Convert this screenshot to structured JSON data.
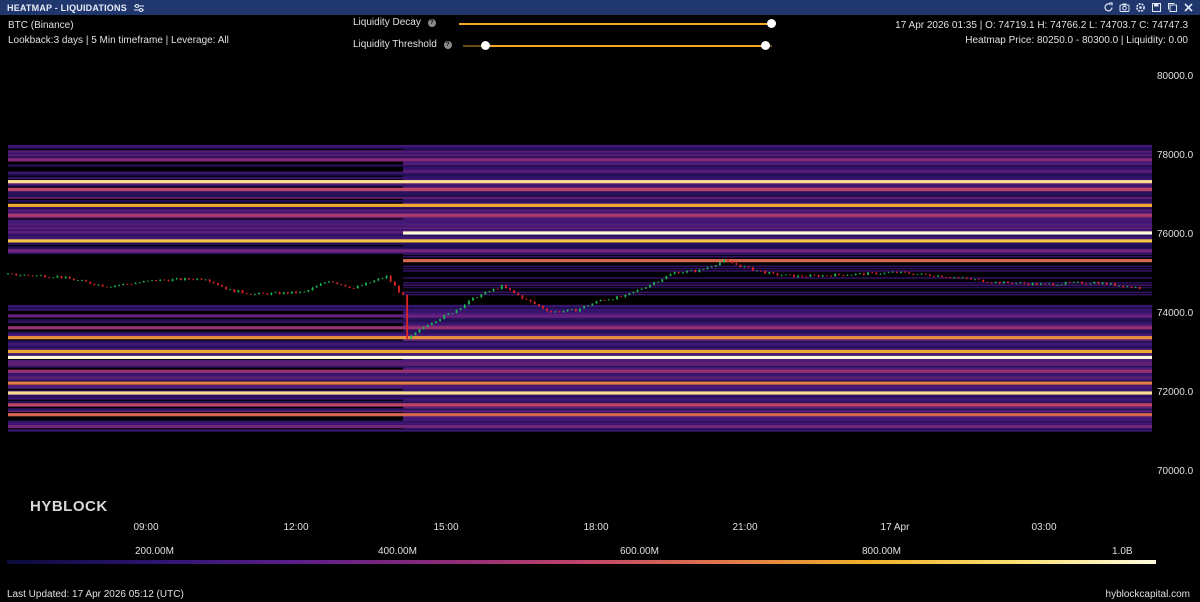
{
  "window": {
    "title": "HEATMAP - LIQUIDATIONS",
    "icons": [
      "refresh-icon",
      "camera-icon",
      "settings-icon",
      "save-icon",
      "copy-icon",
      "close-icon"
    ]
  },
  "info": {
    "symbol": "BTC (Binance)",
    "params": "Lookback:3 days | 5 Min timeframe | Leverage: All",
    "ohlc": "17 Apr 2026 01:35 | O: 74719.1 H: 74766.2 L: 74703.7 C: 74747.3",
    "heatmap_price": "Heatmap Price: 80250.0 - 80300.0 | Liquidity: 0.00"
  },
  "controls": {
    "decay_label": "Liquidity Decay",
    "threshold_label": "Liquidity Threshold",
    "decay_value": 1.0,
    "threshold_range": [
      0.08,
      0.95
    ]
  },
  "brand": {
    "logo": "HYBLOCK",
    "site": "hyblockcapital.com"
  },
  "footer": {
    "updated": "Last Updated: 17 Apr 2026 05:12 (UTC)"
  },
  "legend": {
    "labels": [
      "200.00M",
      "400.00M",
      "600.00M",
      "800.00M",
      "1.0B"
    ]
  },
  "colors": {
    "title_bar": "#20376e",
    "up": "#1db954",
    "down": "#e02424",
    "slider": "#f5a623"
  },
  "chart_data": {
    "type": "heatmap",
    "overlay": "candlestick",
    "x_ticks": [
      "09:00",
      "12:00",
      "15:00",
      "18:00",
      "21:00",
      "17 Apr",
      "03:00"
    ],
    "y_ticks": [
      "80000.0",
      "78000.0",
      "76000.0",
      "74000.0",
      "72000.0",
      "70000.0"
    ],
    "ylim": [
      70000,
      80300
    ],
    "legend_title": "",
    "price_series": [
      {
        "t": "06:00",
        "p": 74950
      },
      {
        "t": "07:00",
        "p": 74900
      },
      {
        "t": "08:00",
        "p": 74650
      },
      {
        "t": "09:00",
        "p": 74800
      },
      {
        "t": "10:00",
        "p": 74850
      },
      {
        "t": "10:30",
        "p": 74550
      },
      {
        "t": "11:00",
        "p": 74450
      },
      {
        "t": "12:00",
        "p": 74500
      },
      {
        "t": "12:30",
        "p": 74800
      },
      {
        "t": "13:00",
        "p": 74600
      },
      {
        "t": "13:40",
        "p": 74900
      },
      {
        "t": "14:00",
        "p": 74400
      },
      {
        "t": "14:05",
        "p": 73300
      },
      {
        "t": "14:30",
        "p": 73700
      },
      {
        "t": "15:00",
        "p": 74000
      },
      {
        "t": "15:30",
        "p": 74400
      },
      {
        "t": "16:00",
        "p": 74650
      },
      {
        "t": "16:30",
        "p": 74300
      },
      {
        "t": "17:00",
        "p": 74000
      },
      {
        "t": "17:30",
        "p": 74050
      },
      {
        "t": "18:00",
        "p": 74300
      },
      {
        "t": "18:30",
        "p": 74400
      },
      {
        "t": "19:00",
        "p": 74700
      },
      {
        "t": "19:30",
        "p": 75000
      },
      {
        "t": "20:00",
        "p": 75050
      },
      {
        "t": "20:30",
        "p": 75300
      },
      {
        "t": "21:00",
        "p": 75100
      },
      {
        "t": "21:30",
        "p": 74950
      },
      {
        "t": "22:00",
        "p": 74900
      },
      {
        "t": "23:00",
        "p": 74950
      },
      {
        "t": "00:00",
        "p": 75000
      },
      {
        "t": "01:00",
        "p": 74900
      },
      {
        "t": "02:00",
        "p": 74750
      },
      {
        "t": "03:00",
        "p": 74700
      },
      {
        "t": "04:00",
        "p": 74750
      },
      {
        "t": "05:00",
        "p": 74600
      }
    ],
    "liquidity_bands": [
      {
        "price": 77850,
        "intensity": 0.45,
        "from": "start"
      },
      {
        "price": 77300,
        "intensity": 0.95,
        "from": "start"
      },
      {
        "price": 77100,
        "intensity": 0.6,
        "from": "start"
      },
      {
        "price": 76700,
        "intensity": 0.85,
        "from": "start"
      },
      {
        "price": 76450,
        "intensity": 0.55,
        "from": "start"
      },
      {
        "price": 76000,
        "intensity": 1.0,
        "from": "14:00"
      },
      {
        "price": 75800,
        "intensity": 0.9,
        "from": "start"
      },
      {
        "price": 75550,
        "intensity": 0.4,
        "from": "start"
      },
      {
        "price": 75300,
        "intensity": 0.7,
        "from": "14:00"
      },
      {
        "price": 73900,
        "intensity": 0.35,
        "from": "start"
      },
      {
        "price": 73600,
        "intensity": 0.5,
        "from": "start"
      },
      {
        "price": 73350,
        "intensity": 0.8,
        "from": "start"
      },
      {
        "price": 73000,
        "intensity": 0.85,
        "from": "start"
      },
      {
        "price": 72850,
        "intensity": 1.0,
        "from": "start"
      },
      {
        "price": 72500,
        "intensity": 0.5,
        "from": "start"
      },
      {
        "price": 72200,
        "intensity": 0.75,
        "from": "start"
      },
      {
        "price": 71950,
        "intensity": 0.95,
        "from": "start"
      },
      {
        "price": 71650,
        "intensity": 0.6,
        "from": "start"
      },
      {
        "price": 71400,
        "intensity": 0.7,
        "from": "start"
      },
      {
        "price": 71100,
        "intensity": 0.4,
        "from": "start"
      }
    ]
  }
}
